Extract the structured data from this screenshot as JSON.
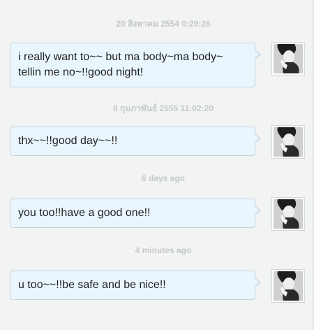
{
  "messages": [
    {
      "timestamp": "20 สิงหาคม 2554 0:29:26",
      "text": "i really want to~~ but ma body~ma body~ tellin me no~!!good night!",
      "avatar_icon": "user-photo-icon"
    },
    {
      "timestamp": "8 กุมภาพันธ์ 2555 11:02:20",
      "text": "thx~~!!good day~~!!",
      "avatar_icon": "user-photo-icon"
    },
    {
      "timestamp": "6 days ago",
      "text": "you too!!have a good one!!",
      "avatar_icon": "user-photo-icon"
    },
    {
      "timestamp": "4 minutes ago",
      "text": "u too~~!!be safe and be nice!!",
      "avatar_icon": "user-photo-icon"
    }
  ],
  "colors": {
    "background": "#f2f3f3",
    "bubble_fill": "#eaf6fe",
    "bubble_border": "#c7d3dc",
    "timestamp_text": "#c6c9cb"
  }
}
